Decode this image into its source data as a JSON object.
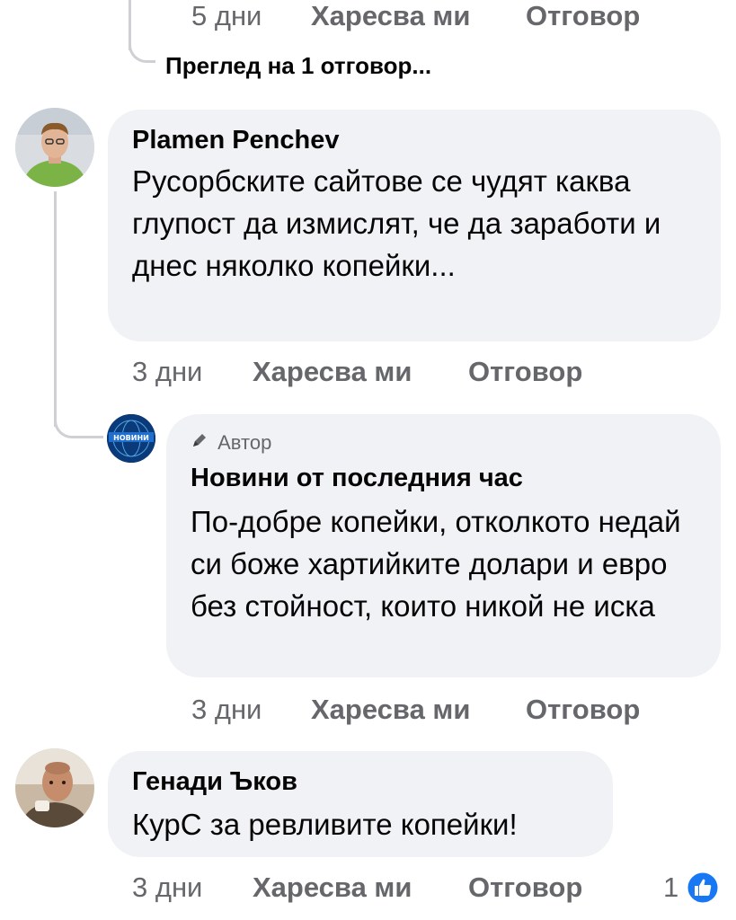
{
  "top_meta": {
    "time": "5 дни",
    "like": "Харесва ми",
    "reply": "Отговор"
  },
  "view_replies": "Преглед на 1 отговор...",
  "comments": [
    {
      "author": "Plamen Penchev",
      "text": "Русорбските сайтове се чудят каква глупост да измислят, че да заработи и днес няколко копейки...",
      "time": "3 дни",
      "like": "Харесва ми",
      "reply": "Отговор"
    },
    {
      "badge_icon": "pencil-icon",
      "badge": "Автор",
      "author": "Новини от последния час",
      "text": "По-добре копейки, отколкото недай си боже хартийките долари и евро без стойност, които никой не иска",
      "avatar_text": "НОВИНИ",
      "time": "3 дни",
      "like": "Харесва ми",
      "reply": "Отговор"
    },
    {
      "author": "Генади Ъков",
      "text": "КурС за ревливите копейки!",
      "time": "3 дни",
      "like": "Харесва ми",
      "reply": "Отговор",
      "reaction_count": "1",
      "reaction_icon": "like-reaction-icon"
    }
  ],
  "colors": {
    "bubble": "#f0f2f5",
    "meta": "#65676b",
    "like_blue": "#1877f2"
  }
}
